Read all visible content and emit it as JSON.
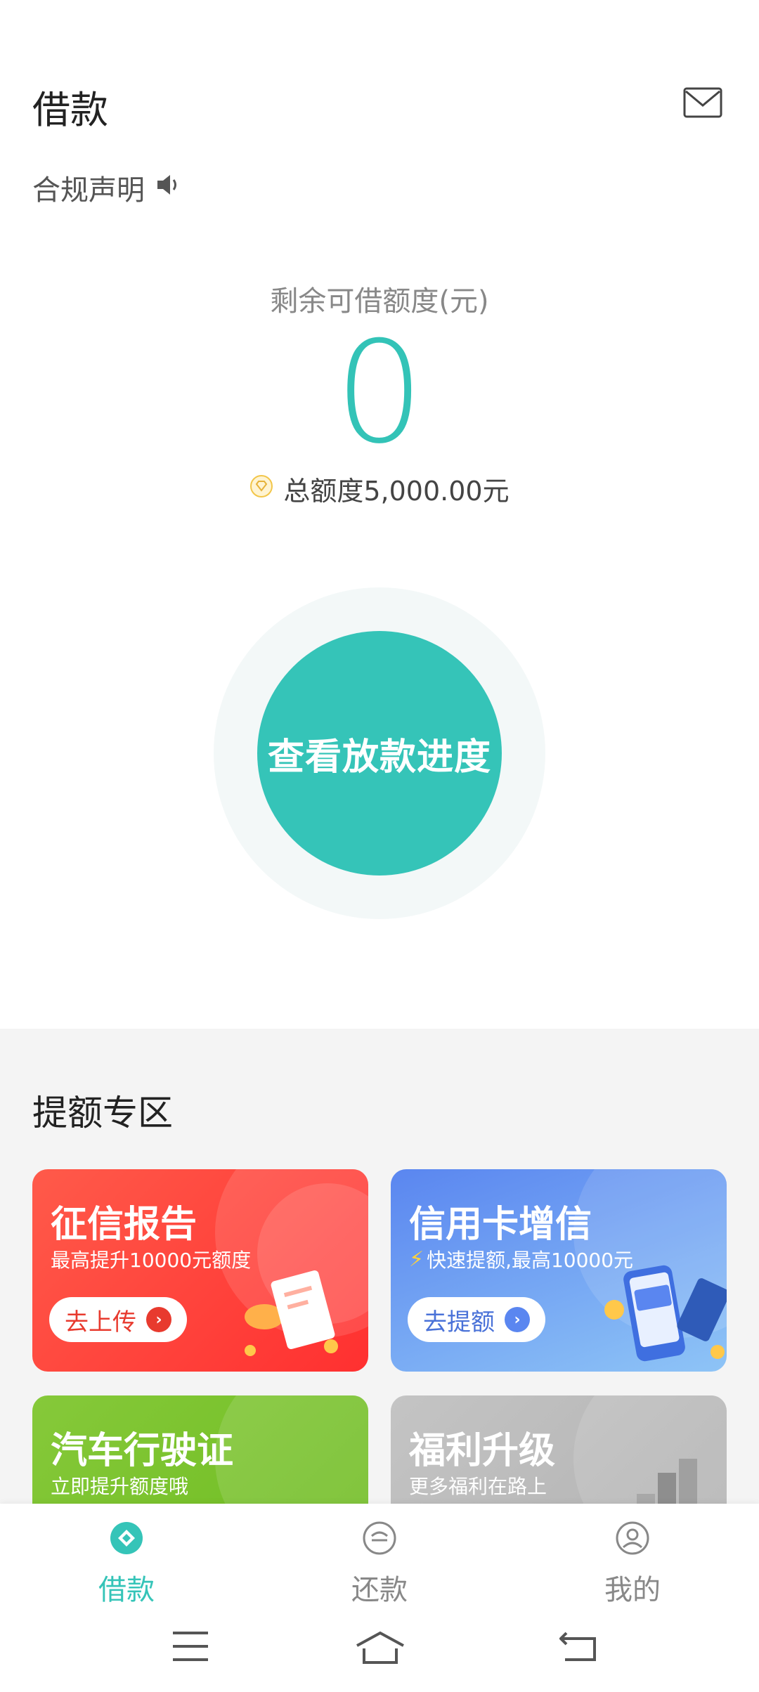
{
  "header": {
    "title": "借款"
  },
  "notice": {
    "label": "合规声明"
  },
  "quota": {
    "label": "剩余可借额度(元)",
    "value": "0",
    "total": "总额度5,000.00元"
  },
  "main_button": {
    "label": "查看放款进度"
  },
  "boost_section": {
    "title": "提额专区",
    "cards": [
      {
        "title": "征信报告",
        "subtitle": "最高提升10000元额度",
        "button": "去上传"
      },
      {
        "title": "信用卡增信",
        "subtitle": "快速提额,最高10000元",
        "button": "去提额"
      },
      {
        "title": "汽车行驶证",
        "subtitle": "立即提升额度哦"
      },
      {
        "title": "福利升级",
        "subtitle": "更多福利在路上"
      }
    ]
  },
  "nav": {
    "items": [
      {
        "label": "借款",
        "active": true
      },
      {
        "label": "还款",
        "active": false
      },
      {
        "label": "我的",
        "active": false
      }
    ]
  },
  "colors": {
    "accent": "#35c4b8",
    "red": "#ff4040",
    "blue": "#5c8cf0",
    "green": "#7cc22c",
    "gray": "#bcbcbc"
  }
}
